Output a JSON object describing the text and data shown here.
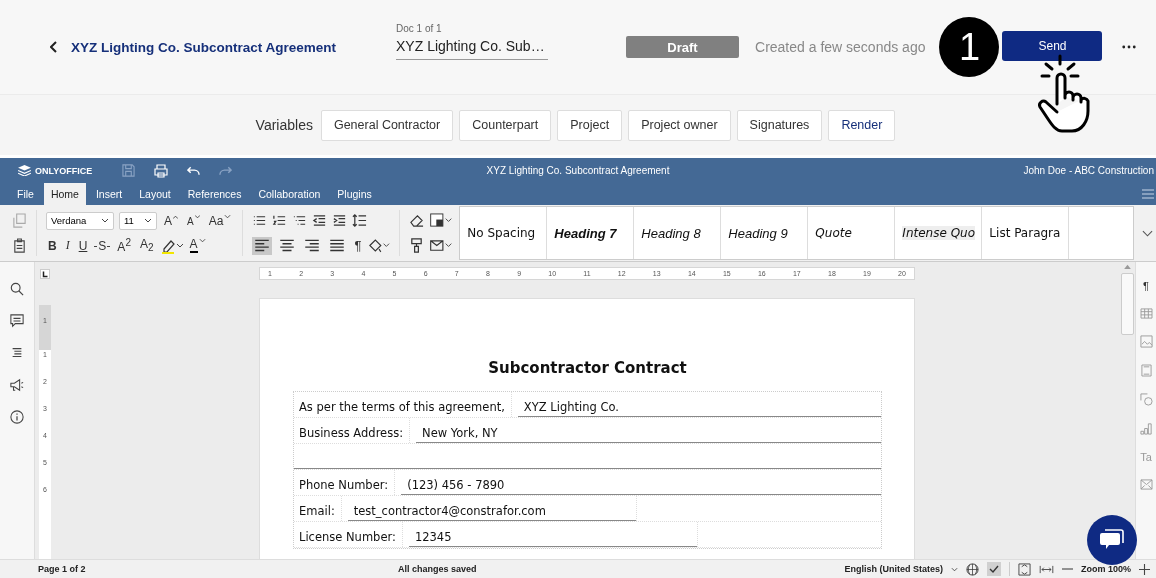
{
  "top_bar": {
    "title": "XYZ Lighting Co. Subcontract Agreement",
    "doc_label": "Doc 1 of 1",
    "doc_value": "XYZ Lighting Co. Sub…",
    "status": "Draft",
    "created": "Created a few seconds ago",
    "step": "1",
    "send": "Send"
  },
  "variables": {
    "label": "Variables",
    "buttons": [
      {
        "label": "General Contractor",
        "kind": "variable"
      },
      {
        "label": "Counterpart",
        "kind": "variable"
      },
      {
        "label": "Project",
        "kind": "variable"
      },
      {
        "label": "Project owner",
        "kind": "variable"
      },
      {
        "label": "Signatures",
        "kind": "variable"
      },
      {
        "label": "Render",
        "kind": "action"
      }
    ]
  },
  "editor": {
    "brand": "ONLYOFFICE",
    "doc_title": "XYZ Lighting Co. Subcontract Agreement",
    "user": "John Doe - ABC Construction",
    "tabs": [
      {
        "label": "File",
        "selected": false
      },
      {
        "label": "Home",
        "selected": true
      },
      {
        "label": "Insert",
        "selected": false
      },
      {
        "label": "Layout",
        "selected": false
      },
      {
        "label": "References",
        "selected": false
      },
      {
        "label": "Collaboration",
        "selected": false
      },
      {
        "label": "Plugins",
        "selected": false
      }
    ],
    "font": "Verdana",
    "size": "11",
    "font_tools": [
      {
        "text": "A",
        "kind": "grow"
      },
      {
        "text": "A",
        "kind": "shrink"
      },
      {
        "text": "Aa",
        "kind": "case"
      }
    ],
    "format_tools": [
      {
        "text": "B",
        "kind": "bold"
      },
      {
        "text": "I",
        "kind": "italic"
      },
      {
        "text": "U",
        "kind": "underline"
      },
      {
        "text": "S",
        "kind": "strike"
      },
      {
        "text": "A$^{2}$",
        "kind": "super"
      },
      {
        "text": "A$_{2}$",
        "kind": "sub"
      },
      {
        "kind": "highlight"
      },
      {
        "text": "A",
        "kind": "color"
      }
    ],
    "alignment": [
      {
        "kind": "left",
        "selected": true
      },
      {
        "kind": "center",
        "selected": false
      },
      {
        "kind": "right",
        "selected": false
      },
      {
        "kind": "justify",
        "selected": false
      }
    ],
    "pilcrow": "¶",
    "styles": [
      {
        "label": "No Spacing",
        "kind": "plain"
      },
      {
        "label": "Heading 7",
        "kind": "bold-italic"
      },
      {
        "label": "Heading 8",
        "kind": "italic"
      },
      {
        "label": "Heading 9",
        "kind": "italic"
      },
      {
        "label": "Quote",
        "kind": "italic-serif"
      },
      {
        "label": "Intense Quo",
        "kind": "shaded"
      },
      {
        "label": "List Paragra",
        "kind": "plain"
      }
    ],
    "ruler_numbers": [
      "1",
      "2",
      "3",
      "4",
      "5",
      "6",
      "7",
      "8",
      "9",
      "10",
      "11",
      "12",
      "13",
      "14",
      "15",
      "16",
      "17",
      "18",
      "19",
      "20"
    ],
    "vertical_ruler_numbers": [
      "1",
      "1",
      "2",
      "3",
      "4",
      "5",
      "6"
    ],
    "right_panel": [
      {
        "kind": "glyph",
        "text": "¶"
      },
      {
        "kind": "table"
      },
      {
        "kind": "image"
      },
      {
        "kind": "header"
      },
      {
        "kind": "shape"
      },
      {
        "kind": "chart"
      },
      {
        "kind": "glyph",
        "text": "Ta"
      },
      {
        "kind": "mail"
      }
    ]
  },
  "document": {
    "heading": "Subcontractor Contract",
    "rows": [
      {
        "kind": "full",
        "label": "As per the terms of this agreement,",
        "value": "XYZ Lighting Co."
      },
      {
        "kind": "full",
        "label": "Business Address:",
        "value": "New York, NY"
      },
      {
        "kind": "blank"
      },
      {
        "kind": "full",
        "label": "Phone Number:",
        "value": "(123) 456 - 7890"
      },
      {
        "kind": "short",
        "label": "Email:",
        "value": "test_contractor4@constrafor.com"
      },
      {
        "kind": "short",
        "label": "License Number:",
        "value": "12345"
      }
    ]
  },
  "status_bar": {
    "page": "Page 1 of 2",
    "save_state": "All changes saved",
    "language": "English (United States)",
    "zoom": "Zoom 100%"
  }
}
